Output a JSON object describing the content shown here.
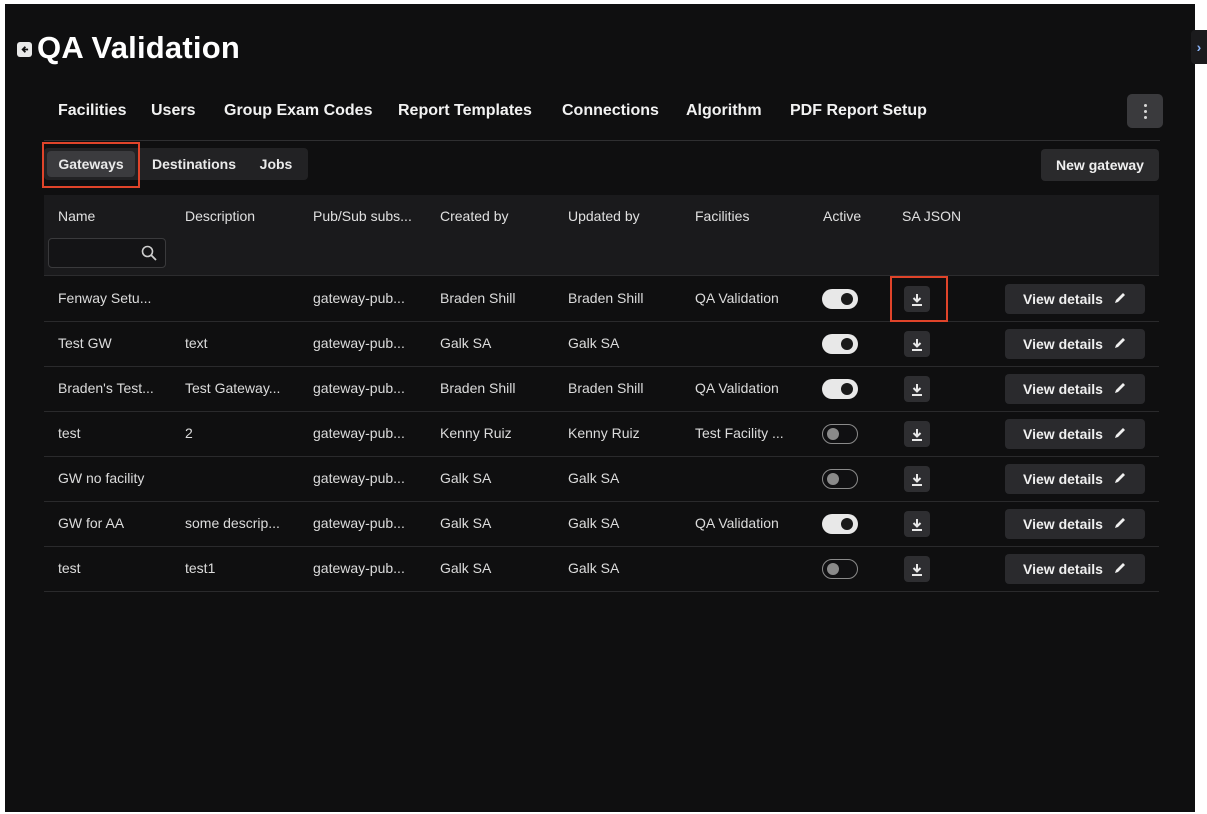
{
  "page": {
    "title": "QA Validation"
  },
  "tabs": [
    "Facilities",
    "Users",
    "Group Exam Codes",
    "Report Templates",
    "Connections",
    "Algorithm",
    "PDF Report Setup"
  ],
  "subtabs": {
    "items": [
      "Gateways",
      "Destinations",
      "Jobs"
    ],
    "active": "Gateways"
  },
  "toolbar": {
    "new_gateway_label": "New gateway"
  },
  "table": {
    "columns": [
      "Name",
      "Description",
      "Pub/Sub subs...",
      "Created by",
      "Updated by",
      "Facilities",
      "Active",
      "SA JSON"
    ],
    "search": {
      "value": "",
      "placeholder": ""
    },
    "view_details_label": "View details",
    "rows": [
      {
        "name": "Fenway Setu...",
        "description": "",
        "pubsub": "gateway-pub...",
        "created_by": "Braden Shill",
        "updated_by": "Braden Shill",
        "facilities": "QA Validation",
        "active": true
      },
      {
        "name": "Test GW",
        "description": "text",
        "pubsub": "gateway-pub...",
        "created_by": "Galk SA",
        "updated_by": "Galk SA",
        "facilities": "",
        "active": true
      },
      {
        "name": "Braden's Test...",
        "description": "Test Gateway...",
        "pubsub": "gateway-pub...",
        "created_by": "Braden Shill",
        "updated_by": "Braden Shill",
        "facilities": "QA Validation",
        "active": true
      },
      {
        "name": "test",
        "description": "2",
        "pubsub": "gateway-pub...",
        "created_by": "Kenny Ruiz",
        "updated_by": "Kenny Ruiz",
        "facilities": "Test Facility ...",
        "active": false
      },
      {
        "name": "GW no facility",
        "description": "",
        "pubsub": "gateway-pub...",
        "created_by": "Galk SA",
        "updated_by": "Galk SA",
        "facilities": "",
        "active": false
      },
      {
        "name": "GW for AA",
        "description": "some descrip...",
        "pubsub": "gateway-pub...",
        "created_by": "Galk SA",
        "updated_by": "Galk SA",
        "facilities": "QA Validation",
        "active": true
      },
      {
        "name": "test",
        "description": "test1",
        "pubsub": "gateway-pub...",
        "created_by": "Galk SA",
        "updated_by": "Galk SA",
        "facilities": "",
        "active": false
      }
    ]
  },
  "highlight_color": "#e0442a",
  "icons": {
    "back": "arrow-left-icon",
    "search": "search-icon",
    "download": "download-icon",
    "edit": "pencil-icon",
    "more": "kebab-icon",
    "collapse": "chevron-right-icon"
  }
}
